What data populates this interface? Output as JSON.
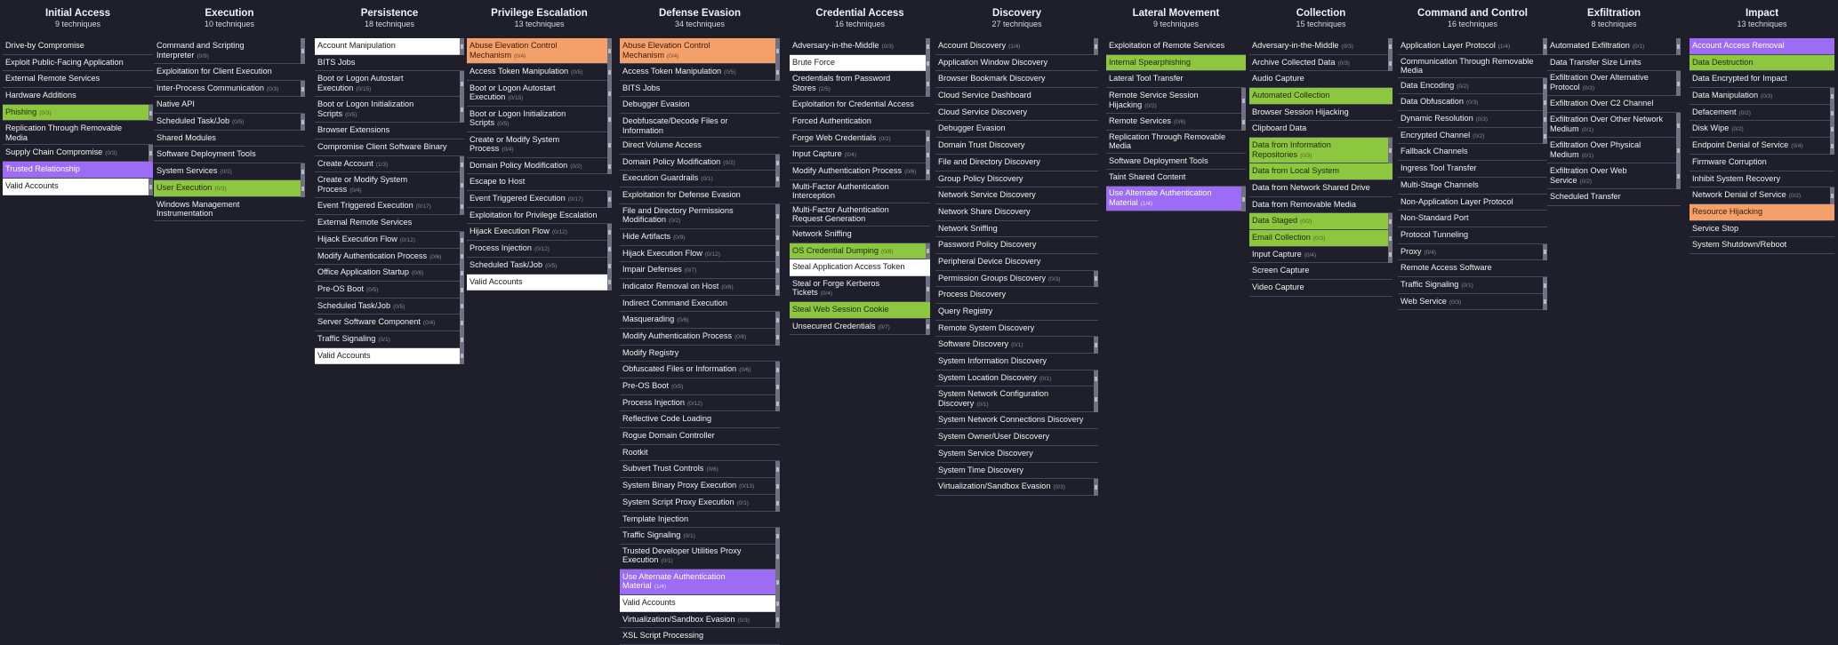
{
  "tactics": [
    {
      "id": "initial-access",
      "name": "Initial Access",
      "count": "9 techniques",
      "techniques": [
        {
          "name": "Drive-by Compromise"
        },
        {
          "name": "Exploit Public-Facing Application"
        },
        {
          "name": "External Remote Services"
        },
        {
          "name": "Hardware Additions"
        },
        {
          "name": "Phishing",
          "count": "(0/3)",
          "color": "green",
          "sub": true
        },
        {
          "name": "Replication Through Removable Media"
        },
        {
          "name": "Supply Chain Compromise",
          "count": "(0/3)",
          "sub": true
        },
        {
          "name": "Trusted Relationship",
          "color": "purple"
        },
        {
          "name": "Valid Accounts",
          "color": "white",
          "sub": true
        }
      ]
    },
    {
      "id": "execution",
      "name": "Execution",
      "count": "10 techniques",
      "techniques": [
        {
          "name": "Command and Scripting Interpreter",
          "count": "(0/9)",
          "sub": true
        },
        {
          "name": "Exploitation for Client Execution"
        },
        {
          "name": "Inter-Process Communication",
          "count": "(0/3)",
          "sub": true
        },
        {
          "name": "Native API"
        },
        {
          "name": "Scheduled Task/Job",
          "count": "(0/5)",
          "sub": true
        },
        {
          "name": "Shared Modules"
        },
        {
          "name": "Software Deployment Tools"
        },
        {
          "name": "System Services",
          "count": "(0/2)",
          "sub": true
        },
        {
          "name": "User Execution",
          "count": "(0/3)",
          "color": "green",
          "sub": true
        },
        {
          "name": "Windows Management Instrumentation"
        }
      ]
    },
    {
      "id": "persistence",
      "name": "Persistence",
      "count": "18 techniques",
      "techniques": [
        {
          "name": "Account Manipulation",
          "color": "white",
          "sub": true
        },
        {
          "name": "BITS Jobs"
        },
        {
          "name": "Boot or Logon Autostart Execution",
          "count": "(0/15)",
          "sub": true
        },
        {
          "name": "Boot or Logon Initialization Scripts",
          "count": "(0/5)",
          "sub": true
        },
        {
          "name": "Browser Extensions"
        },
        {
          "name": "Compromise Client Software Binary"
        },
        {
          "name": "Create Account",
          "count": "(1/3)",
          "sub": true
        },
        {
          "name": "Create or Modify System Process",
          "count": "(0/4)",
          "sub": true
        },
        {
          "name": "Event Triggered Execution",
          "count": "(0/17)",
          "sub": true
        },
        {
          "name": "External Remote Services"
        },
        {
          "name": "Hijack Execution Flow",
          "count": "(0/12)",
          "sub": true
        },
        {
          "name": "Modify Authentication Process",
          "count": "(0/6)",
          "sub": true
        },
        {
          "name": "Office Application Startup",
          "count": "(0/6)",
          "sub": true
        },
        {
          "name": "Pre-OS Boot",
          "count": "(0/5)",
          "sub": true
        },
        {
          "name": "Scheduled Task/Job",
          "count": "(0/5)",
          "sub": true
        },
        {
          "name": "Server Software Component",
          "count": "(0/4)",
          "sub": true
        },
        {
          "name": "Traffic Signaling",
          "count": "(0/1)",
          "sub": true
        },
        {
          "name": "Valid Accounts",
          "color": "white",
          "sub": true
        }
      ]
    },
    {
      "id": "privilege-escalation",
      "name": "Privilege Escalation",
      "count": "13 techniques",
      "techniques": [
        {
          "name": "Abuse Elevation Control Mechanism",
          "count": "(0/4)",
          "color": "orange",
          "sub": true
        },
        {
          "name": "Access Token Manipulation",
          "count": "(0/5)",
          "sub": true
        },
        {
          "name": "Boot or Logon Autostart Execution",
          "count": "(0/15)",
          "sub": true
        },
        {
          "name": "Boot or Logon Initialization Scripts",
          "count": "(0/5)",
          "sub": true
        },
        {
          "name": "Create or Modify System Process",
          "count": "(0/4)",
          "sub": true
        },
        {
          "name": "Domain Policy Modification",
          "count": "(0/2)",
          "sub": true
        },
        {
          "name": "Escape to Host"
        },
        {
          "name": "Event Triggered Execution",
          "count": "(0/17)",
          "sub": true
        },
        {
          "name": "Exploitation for Privilege Escalation"
        },
        {
          "name": "Hijack Execution Flow",
          "count": "(0/12)",
          "sub": true
        },
        {
          "name": "Process Injection",
          "count": "(0/12)",
          "sub": true
        },
        {
          "name": "Scheduled Task/Job",
          "count": "(0/5)",
          "sub": true
        },
        {
          "name": "Valid Accounts",
          "color": "white",
          "sub": true
        }
      ]
    },
    {
      "id": "defense-evasion",
      "name": "Defense Evasion",
      "count": "34 techniques",
      "techniques": [
        {
          "name": "Abuse Elevation Control Mechanism",
          "count": "(0/4)",
          "color": "orange",
          "sub": true
        },
        {
          "name": "Access Token Manipulation",
          "count": "(0/5)",
          "sub": true
        },
        {
          "name": "BITS Jobs"
        },
        {
          "name": "Debugger Evasion"
        },
        {
          "name": "Deobfuscate/Decode Files or Information"
        },
        {
          "name": "Direct Volume Access"
        },
        {
          "name": "Domain Policy Modification",
          "count": "(0/2)",
          "sub": true
        },
        {
          "name": "Execution Guardrails",
          "count": "(0/1)",
          "sub": true
        },
        {
          "name": "Exploitation for Defense Evasion"
        },
        {
          "name": "File and Directory Permissions Modification",
          "count": "(0/2)",
          "sub": true,
          "lines": 2
        },
        {
          "name": "Hide Artifacts",
          "count": "(0/9)",
          "sub": true
        },
        {
          "name": "Hijack Execution Flow",
          "count": "(0/12)",
          "sub": true
        },
        {
          "name": "Impair Defenses",
          "count": "(0/7)",
          "sub": true
        },
        {
          "name": "Indicator Removal on Host",
          "count": "(0/6)",
          "sub": true
        },
        {
          "name": "Indirect Command Execution"
        },
        {
          "name": "Masquerading",
          "count": "(0/6)",
          "sub": true
        },
        {
          "name": "Modify Authentication Process",
          "count": "(0/6)",
          "sub": true
        },
        {
          "name": "Modify Registry"
        },
        {
          "name": "Obfuscated Files or Information",
          "count": "(0/6)",
          "sub": true
        },
        {
          "name": "Pre-OS Boot",
          "count": "(0/5)",
          "sub": true
        },
        {
          "name": "Process Injection",
          "count": "(0/12)",
          "sub": true
        },
        {
          "name": "Reflective Code Loading"
        },
        {
          "name": "Rogue Domain Controller"
        },
        {
          "name": "Rootkit"
        },
        {
          "name": "Subvert Trust Controls",
          "count": "(0/6)",
          "sub": true
        },
        {
          "name": "System Binary Proxy Execution",
          "count": "(0/13)",
          "sub": true
        },
        {
          "name": "System Script Proxy Execution",
          "count": "(0/1)",
          "sub": true
        },
        {
          "name": "Template Injection"
        },
        {
          "name": "Traffic Signaling",
          "count": "(0/1)",
          "sub": true
        },
        {
          "name": "Trusted Developer Utilities Proxy Execution",
          "count": "(0/1)",
          "sub": true,
          "lines": 2
        },
        {
          "name": "Use Alternate Authentication Material",
          "count": "(1/4)",
          "color": "purple",
          "sub": true
        },
        {
          "name": "Valid Accounts",
          "color": "white",
          "sub": true
        },
        {
          "name": "Virtualization/Sandbox Evasion",
          "count": "(0/3)",
          "sub": true
        },
        {
          "name": "XSL Script Processing"
        }
      ]
    },
    {
      "id": "credential-access",
      "name": "Credential Access",
      "count": "16 techniques",
      "techniques": [
        {
          "name": "Adversary-in-the-Middle",
          "count": "(0/3)",
          "sub": true
        },
        {
          "name": "Brute Force",
          "color": "white",
          "sub": true
        },
        {
          "name": "Credentials from Password Stores",
          "count": "(2/5)",
          "sub": true
        },
        {
          "name": "Exploitation for Credential Access"
        },
        {
          "name": "Forced Authentication"
        },
        {
          "name": "Forge Web Credentials",
          "count": "(0/2)",
          "sub": true
        },
        {
          "name": "Input Capture",
          "count": "(0/4)",
          "sub": true
        },
        {
          "name": "Modify Authentication Process",
          "count": "(0/6)",
          "sub": true
        },
        {
          "name": "Multi-Factor Authentication Interception",
          "lines": 2
        },
        {
          "name": "Multi-Factor Authentication Request Generation",
          "lines": 2
        },
        {
          "name": "Network Sniffing"
        },
        {
          "name": "OS Credential Dumping",
          "count": "(0/8)",
          "color": "green",
          "sub": true
        },
        {
          "name": "Steal Application Access Token",
          "color": "white"
        },
        {
          "name": "Steal or Forge Kerberos Tickets",
          "count": "(0/4)",
          "sub": true
        },
        {
          "name": "Steal Web Session Cookie",
          "color": "green"
        },
        {
          "name": "Unsecured Credentials",
          "count": "(0/7)",
          "sub": true
        }
      ]
    },
    {
      "id": "discovery",
      "name": "Discovery",
      "count": "27 techniques",
      "techniques": [
        {
          "name": "Account Discovery",
          "count": "(1/4)",
          "sub": true
        },
        {
          "name": "Application Window Discovery"
        },
        {
          "name": "Browser Bookmark Discovery"
        },
        {
          "name": "Cloud Service Dashboard"
        },
        {
          "name": "Cloud Service Discovery"
        },
        {
          "name": "Debugger Evasion"
        },
        {
          "name": "Domain Trust Discovery"
        },
        {
          "name": "File and Directory Discovery"
        },
        {
          "name": "Group Policy Discovery"
        },
        {
          "name": "Network Service Discovery"
        },
        {
          "name": "Network Share Discovery"
        },
        {
          "name": "Network Sniffing"
        },
        {
          "name": "Password Policy Discovery"
        },
        {
          "name": "Peripheral Device Discovery"
        },
        {
          "name": "Permission Groups Discovery",
          "count": "(0/3)",
          "sub": true
        },
        {
          "name": "Process Discovery"
        },
        {
          "name": "Query Registry"
        },
        {
          "name": "Remote System Discovery"
        },
        {
          "name": "Software Discovery",
          "count": "(0/1)",
          "sub": true
        },
        {
          "name": "System Information Discovery"
        },
        {
          "name": "System Location Discovery",
          "count": "(0/1)",
          "sub": true
        },
        {
          "name": "System Network Configuration Discovery",
          "count": "(0/1)",
          "sub": true
        },
        {
          "name": "System Network Connections Discovery"
        },
        {
          "name": "System Owner/User Discovery"
        },
        {
          "name": "System Service Discovery"
        },
        {
          "name": "System Time Discovery"
        },
        {
          "name": "Virtualization/Sandbox Evasion",
          "count": "(0/3)",
          "sub": true
        }
      ]
    },
    {
      "id": "lateral-movement",
      "name": "Lateral Movement",
      "count": "9 techniques",
      "techniques": [
        {
          "name": "Exploitation of Remote Services"
        },
        {
          "name": "Internal Spearphishing",
          "color": "green"
        },
        {
          "name": "Lateral Tool Transfer"
        },
        {
          "name": "Remote Service Session Hijacking",
          "count": "(0/2)",
          "sub": true
        },
        {
          "name": "Remote Services",
          "count": "(0/6)",
          "sub": true
        },
        {
          "name": "Replication Through Removable Media",
          "lines": 2
        },
        {
          "name": "Software Deployment Tools"
        },
        {
          "name": "Taint Shared Content"
        },
        {
          "name": "Use Alternate Authentication Material",
          "count": "(1/4)",
          "color": "purple",
          "sub": true,
          "lines": 2
        }
      ]
    },
    {
      "id": "collection",
      "name": "Collection",
      "count": "15 techniques",
      "techniques": [
        {
          "name": "Adversary-in-the-Middle",
          "count": "(0/3)",
          "sub": true
        },
        {
          "name": "Archive Collected Data",
          "count": "(0/3)",
          "sub": true
        },
        {
          "name": "Audio Capture"
        },
        {
          "name": "Automated Collection",
          "color": "green"
        },
        {
          "name": "Browser Session Hijacking"
        },
        {
          "name": "Clipboard Data"
        },
        {
          "name": "Data from Information Repositories",
          "count": "(0/3)",
          "color": "green",
          "sub": true
        },
        {
          "name": "Data from Local System",
          "color": "green"
        },
        {
          "name": "Data from Network Shared Drive"
        },
        {
          "name": "Data from Removable Media"
        },
        {
          "name": "Data Staged",
          "count": "(0/2)",
          "color": "green",
          "sub": true
        },
        {
          "name": "Email Collection",
          "count": "(0/3)",
          "color": "green",
          "sub": true
        },
        {
          "name": "Input Capture",
          "count": "(0/4)",
          "sub": true
        },
        {
          "name": "Screen Capture"
        },
        {
          "name": "Video Capture"
        }
      ]
    },
    {
      "id": "command-and-control",
      "name": "Command and Control",
      "count": "16 techniques",
      "techniques": [
        {
          "name": "Application Layer Protocol",
          "count": "(1/4)",
          "sub": true
        },
        {
          "name": "Communication Through Removable Media",
          "lines": 2
        },
        {
          "name": "Data Encoding",
          "count": "(0/2)",
          "sub": true
        },
        {
          "name": "Data Obfuscation",
          "count": "(0/3)",
          "sub": true
        },
        {
          "name": "Dynamic Resolution",
          "count": "(0/3)",
          "sub": true
        },
        {
          "name": "Encrypted Channel",
          "count": "(0/2)",
          "sub": true
        },
        {
          "name": "Fallback Channels"
        },
        {
          "name": "Ingress Tool Transfer"
        },
        {
          "name": "Multi-Stage Channels"
        },
        {
          "name": "Non-Application Layer Protocol"
        },
        {
          "name": "Non-Standard Port"
        },
        {
          "name": "Protocol Tunneling"
        },
        {
          "name": "Proxy",
          "count": "(0/4)",
          "sub": true
        },
        {
          "name": "Remote Access Software"
        },
        {
          "name": "Traffic Signaling",
          "count": "(0/1)",
          "sub": true
        },
        {
          "name": "Web Service",
          "count": "(0/3)",
          "sub": true
        }
      ]
    },
    {
      "id": "exfiltration",
      "name": "Exfiltration",
      "count": "8 techniques",
      "techniques": [
        {
          "name": "Automated Exfiltration",
          "count": "(0/1)",
          "sub": true
        },
        {
          "name": "Data Transfer Size Limits"
        },
        {
          "name": "Exfiltration Over Alternative Protocol",
          "count": "(0/3)",
          "sub": true,
          "lines": 2
        },
        {
          "name": "Exfiltration Over C2 Channel"
        },
        {
          "name": "Exfiltration Over Other Network Medium",
          "count": "(0/1)",
          "sub": true,
          "lines": 2
        },
        {
          "name": "Exfiltration Over Physical Medium",
          "count": "(0/1)",
          "sub": true
        },
        {
          "name": "Exfiltration Over Web Service",
          "count": "(0/2)",
          "sub": true
        },
        {
          "name": "Scheduled Transfer"
        }
      ]
    },
    {
      "id": "impact",
      "name": "Impact",
      "count": "13 techniques",
      "techniques": [
        {
          "name": "Account Access Removal",
          "color": "purple"
        },
        {
          "name": "Data Destruction",
          "color": "green"
        },
        {
          "name": "Data Encrypted for Impact"
        },
        {
          "name": "Data Manipulation",
          "count": "(0/3)",
          "sub": true
        },
        {
          "name": "Defacement",
          "count": "(0/2)",
          "sub": true
        },
        {
          "name": "Disk Wipe",
          "count": "(0/2)",
          "sub": true
        },
        {
          "name": "Endpoint Denial of Service",
          "count": "(0/4)",
          "sub": true
        },
        {
          "name": "Firmware Corruption"
        },
        {
          "name": "Inhibit System Recovery"
        },
        {
          "name": "Network Denial of Service",
          "count": "(0/2)",
          "sub": true
        },
        {
          "name": "Resource Hijacking",
          "color": "orange"
        },
        {
          "name": "Service Stop"
        },
        {
          "name": "System Shutdown/Reboot"
        }
      ]
    }
  ],
  "colors": {
    "green": "#8dc63f",
    "purple": "#9d6cf5",
    "orange": "#f4a06b",
    "white": "#ffffff",
    "background": "#1e1f2b"
  }
}
